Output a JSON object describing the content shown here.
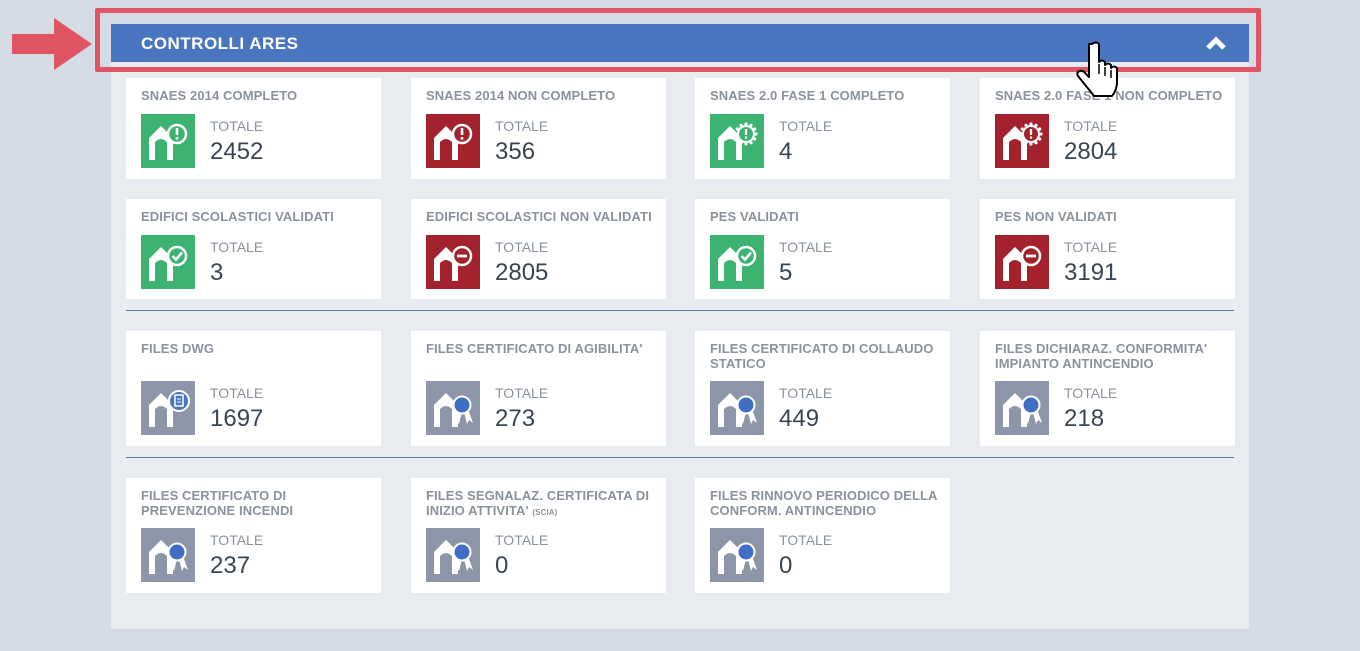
{
  "header": {
    "title": "CONTROLLI ARES"
  },
  "total_label": "TOTALE",
  "colors": {
    "green": "#3cb371",
    "red": "#a3222e",
    "gray": "#8d96a8",
    "header": "#4a76c0"
  },
  "rows": [
    [
      {
        "title": "SNAES 2014 COMPLETO",
        "value": "2452",
        "icon": "building-alert-icon",
        "color": "green"
      },
      {
        "title": "SNAES 2014 NON COMPLETO",
        "value": "356",
        "icon": "building-alert-icon",
        "color": "red"
      },
      {
        "title": "SNAES 2.0 FASE 1 COMPLETO",
        "value": "4",
        "icon": "building-gear-icon",
        "color": "green"
      },
      {
        "title": "SNAES 2.0 FASE 1 NON COMPLETO",
        "value": "2804",
        "icon": "building-gear-icon",
        "color": "red"
      }
    ],
    [
      {
        "title": "EDIFICI SCOLASTICI VALIDATI",
        "value": "3",
        "icon": "building-check-icon",
        "color": "green"
      },
      {
        "title": "EDIFICI SCOLASTICI NON VALIDATI",
        "value": "2805",
        "icon": "building-minus-icon",
        "color": "red"
      },
      {
        "title": "PES VALIDATI",
        "value": "5",
        "icon": "building-check-icon",
        "color": "green"
      },
      {
        "title": "PES NON VALIDATI",
        "value": "3191",
        "icon": "building-minus-icon",
        "color": "red"
      }
    ],
    [
      {
        "title": "FILES DWG",
        "value": "1697",
        "icon": "building-file-icon",
        "color": "gray"
      },
      {
        "title": "FILES CERTIFICATO DI AGIBILITA'",
        "value": "273",
        "icon": "building-ribbon-icon",
        "color": "gray"
      },
      {
        "title": "FILES CERTIFICATO DI COLLAUDO STATICO",
        "value": "449",
        "icon": "building-ribbon-icon",
        "color": "gray"
      },
      {
        "title": "FILES DICHIARAZ. CONFORMITA' IMPIANTO ANTINCENDIO",
        "value": "218",
        "icon": "building-ribbon-icon",
        "color": "gray"
      }
    ],
    [
      {
        "title": "FILES CERTIFICATO DI PREVENZIONE INCENDI",
        "value": "237",
        "icon": "building-ribbon-icon",
        "color": "gray"
      },
      {
        "title": "FILES SEGNALAZ. CERTIFICATA DI INIZIO ATTIVITA'",
        "title_small": "(SCIA)",
        "value": "0",
        "icon": "building-ribbon-icon",
        "color": "gray"
      },
      {
        "title": "FILES RINNOVO PERIODICO DELLA CONFORM. ANTINCENDIO",
        "value": "0",
        "icon": "building-ribbon-icon",
        "color": "gray"
      }
    ]
  ]
}
